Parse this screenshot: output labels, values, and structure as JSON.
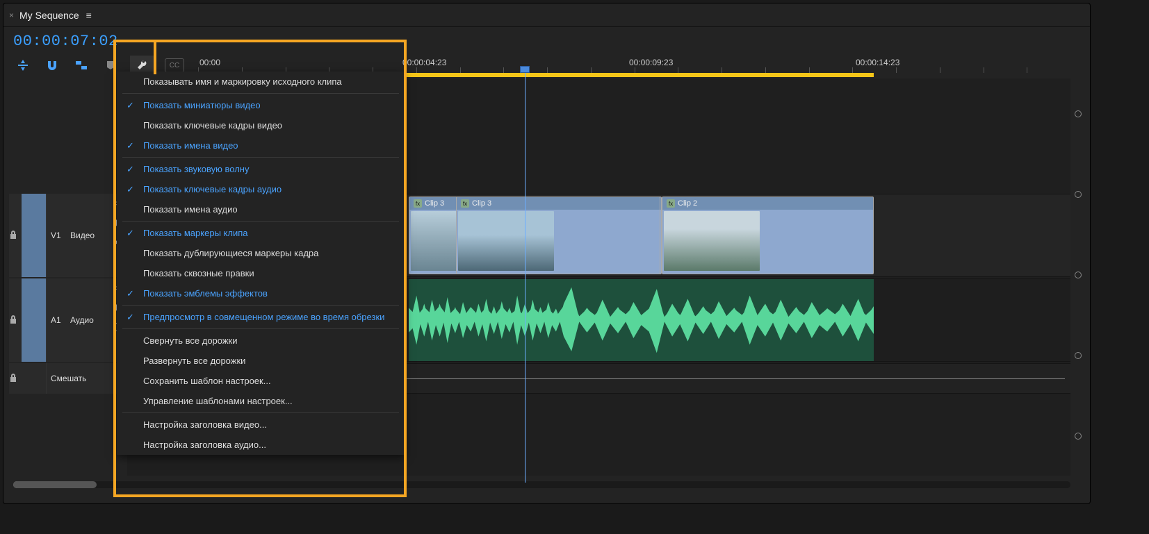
{
  "tab": {
    "title": "My Sequence",
    "close": "×",
    "menu": "≡"
  },
  "timecode": "00:00:07:02",
  "ruler": [
    "00:00",
    "00:00:04:23",
    "00:00:09:23",
    "00:00:14:23"
  ],
  "tracks": {
    "video": {
      "id": "V1",
      "label": "Видео"
    },
    "audio": {
      "id": "A1",
      "label": "Аудио"
    },
    "mix": {
      "label": "Смешать"
    }
  },
  "clips": [
    {
      "name": "Clip 3"
    },
    {
      "name": "Clip 2"
    }
  ],
  "cc": "CC",
  "menu": {
    "groups": [
      [
        {
          "label": "Показывать имя и маркировку исходного клипа",
          "checked": false
        }
      ],
      [
        {
          "label": "Показать миниатюры видео",
          "checked": true
        },
        {
          "label": "Показать ключевые кадры видео",
          "checked": false
        },
        {
          "label": "Показать имена видео",
          "checked": true
        }
      ],
      [
        {
          "label": "Показать звуковую волну",
          "checked": true
        },
        {
          "label": "Показать ключевые кадры аудио",
          "checked": true
        },
        {
          "label": "Показать имена аудио",
          "checked": false
        }
      ],
      [
        {
          "label": "Показать маркеры клипа",
          "checked": true
        },
        {
          "label": "Показать дублирующиеся маркеры кадра",
          "checked": false
        },
        {
          "label": "Показать сквозные правки",
          "checked": false
        },
        {
          "label": "Показать эмблемы эффектов",
          "checked": true
        }
      ],
      [
        {
          "label": "Предпросмотр в совмещенном режиме во время обрезки",
          "checked": true
        }
      ],
      [
        {
          "label": "Свернуть все дорожки",
          "checked": false
        },
        {
          "label": "Развернуть все дорожки",
          "checked": false
        },
        {
          "label": "Сохранить шаблон настроек...",
          "checked": false
        },
        {
          "label": "Управление шаблонами настроек...",
          "checked": false
        }
      ],
      [
        {
          "label": "Настройка заголовка видео...",
          "checked": false
        },
        {
          "label": "Настройка заголовка аудио...",
          "checked": false
        }
      ]
    ]
  }
}
